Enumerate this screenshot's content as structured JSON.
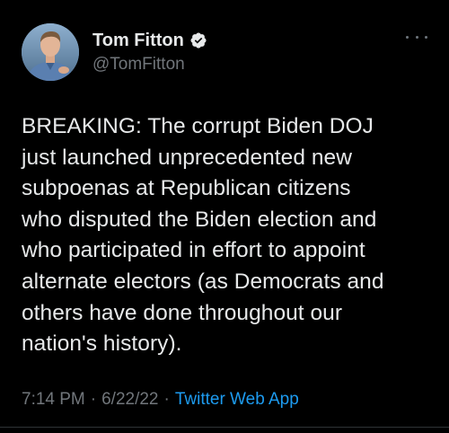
{
  "author": {
    "display_name": "Tom Fitton",
    "handle": "@TomFitton",
    "verified": true,
    "avatar_icon": "profile-photo"
  },
  "tweet": {
    "text": "BREAKING: The corrupt Biden DOJ\njust launched unprecedented new\nsubpoenas at Republican citizens\nwho disputed the Biden election and\nwho participated in effort to appoint\nalternate electors (as Democrats and\nothers have done throughout our\nnation's history).",
    "time": "7:14 PM",
    "date": "6/22/22",
    "separator": "·",
    "source": "Twitter Web App"
  },
  "colors": {
    "background": "#000000",
    "text": "#e7e9ea",
    "muted": "#71767b",
    "accent": "#1d9bf0"
  },
  "icons": {
    "verified": "verified-badge-icon",
    "more": "more-options-icon"
  }
}
